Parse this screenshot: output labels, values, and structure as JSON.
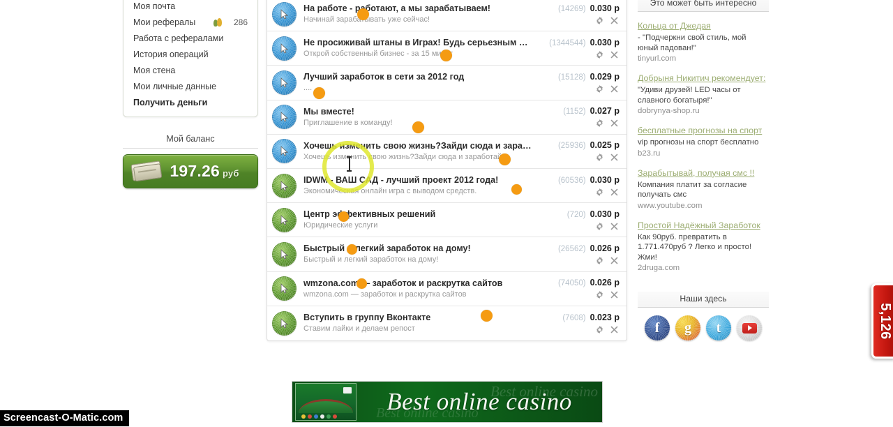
{
  "sidebar_left": {
    "menu_items": [
      {
        "label": "Моя почта",
        "bold": false,
        "icon": null,
        "count": null
      },
      {
        "label": "Мои рефералы",
        "bold": false,
        "icon": "referrals-icon",
        "count": "286"
      },
      {
        "label": "Работа с рефералами",
        "bold": false,
        "icon": null,
        "count": null
      },
      {
        "label": "История операций",
        "bold": false,
        "icon": null,
        "count": null
      },
      {
        "label": "Моя стена",
        "bold": false,
        "icon": null,
        "count": null
      },
      {
        "label": "Мои личные данные",
        "bold": false,
        "icon": null,
        "count": null
      },
      {
        "label": "Получить деньги",
        "bold": true,
        "icon": null,
        "count": null
      }
    ],
    "balance": {
      "title": "Мой баланс",
      "amount": "197.26",
      "currency": "руб",
      "icon": "money-icon",
      "accent_color": "#5e9230"
    }
  },
  "ad_list": {
    "action_icons": {
      "settings": "gear-icon",
      "remove": "close-icon"
    },
    "currency_symbol": "р",
    "rows": [
      {
        "icon": "cursor-badge-blue-icon",
        "title": "На работе - работают, а мы зарабатываем!",
        "subtitle": "Начинай зарабатывать уже сейчас!",
        "count": "(14269)",
        "price": "0.030"
      },
      {
        "icon": "cursor-badge-blue-icon",
        "title": "Не просиживай штаны в Играх! Будь серьезным человеком!",
        "subtitle": "Открой собственный бизнес - за 15 минут",
        "count": "(1344544)",
        "price": "0.030"
      },
      {
        "icon": "cursor-badge-blue-icon",
        "title": "Лучший заработок в сети за 2012 год",
        "subtitle": "....",
        "count": "(15128)",
        "price": "0.029"
      },
      {
        "icon": "cursor-badge-blue-icon",
        "title": "Мы вместе!",
        "subtitle": "Приглашение в команду!",
        "count": "(1152)",
        "price": "0.027"
      },
      {
        "icon": "cursor-badge-blue-icon",
        "title": "Хочешь изменить свою жизнь?Зайди сюда и заработай!",
        "subtitle": "Хочешь изменить свою жизнь?Зайди сюда и заработай!",
        "count": "(25936)",
        "price": "0.025"
      },
      {
        "icon": "cursor-badge-green-icon",
        "title": "IDWM - ВАШ САД - лучший проект 2012 года!",
        "subtitle": "Экономическая онлайн игра с выводом средств.",
        "count": "(60536)",
        "price": "0.030"
      },
      {
        "icon": "cursor-badge-green-icon",
        "title": "Центр эффективных решений",
        "subtitle": "Юридические услуги",
        "count": "(720)",
        "price": "0.030"
      },
      {
        "icon": "cursor-badge-green-icon",
        "title": "Быстрый и легкий заработок на дому!",
        "subtitle": "Быстрый и легкий заработок на дому!",
        "count": "(26562)",
        "price": "0.026"
      },
      {
        "icon": "cursor-badge-green-icon",
        "title": "wmzona.com — заработок и раскрутка сайтов",
        "subtitle": "wmzona.com — заработок и раскрутка сайтов",
        "count": "(74050)",
        "price": "0.026"
      },
      {
        "icon": "cursor-badge-green-icon",
        "title": "Вступить в группу Вконтакте",
        "subtitle": "Ставим лайки и делаем репост",
        "count": "(7608)",
        "price": "0.023"
      }
    ]
  },
  "sidebar_right": {
    "promo_panel_title": "Это может быть интересно",
    "promos": [
      {
        "title": "Кольца от Джедая",
        "desc": "- \"Подчеркни свой стиль, мой юный падован!\"",
        "url": "tinyurl.com"
      },
      {
        "title": "Добрыня Никитич рекомендует:",
        "desc": "\"Удиви друзей! LED часы от славного богатыря!\"",
        "url": "dobrynya-shop.ru"
      },
      {
        "title": "бесплатные прогнозы на спорт",
        "desc": "vip прогнозы на спорт бесплатно",
        "url": "b23.ru"
      },
      {
        "title": "Зарабытывай, получая смс !!",
        "desc": "Компания платит за согласие получать смс",
        "url": "www.youtube.com"
      },
      {
        "title": "Простой Надёжный Заработок",
        "desc": "Как 90руб. превратить в 1.771.470руб ? Легко и просто! Жми!",
        "url": "2druga.com"
      }
    ],
    "social_panel_title": "Наши здесь",
    "social_icons": [
      {
        "name": "facebook-icon",
        "glyph": "f"
      },
      {
        "name": "google-plus-icon",
        "glyph": "g"
      },
      {
        "name": "twitter-icon",
        "glyph": "t"
      },
      {
        "name": "youtube-icon",
        "glyph": ""
      }
    ]
  },
  "side_tab": {
    "label": "5,126"
  },
  "banner": {
    "title": "Best online casino",
    "ghost_text": "Best online casino",
    "ghost_text2": "Best online casino"
  },
  "watermark": {
    "text": "Screencast-O-Matic.com"
  }
}
